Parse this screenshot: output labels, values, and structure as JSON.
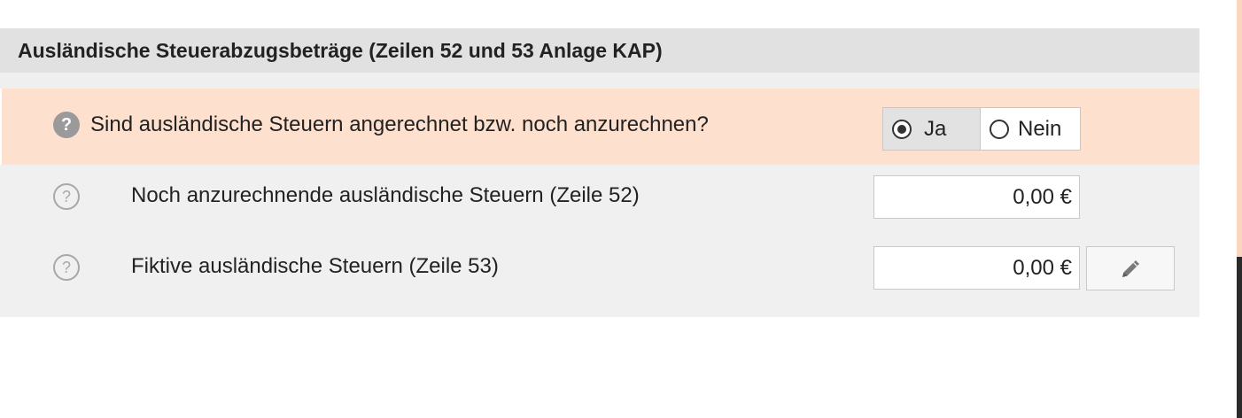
{
  "section": {
    "title": "Ausländische Steuerabzugsbeträge (Zeilen 52 und 53 Anlage KAP)"
  },
  "question": {
    "help_glyph": "?",
    "text": "Sind ausländische Steuern angerechnet bzw. noch anzurechnen?",
    "options": [
      {
        "label": "Ja",
        "selected": true
      },
      {
        "label": "Nein",
        "selected": false
      }
    ]
  },
  "fields": [
    {
      "help_glyph": "?",
      "label": "Noch anzurechnende ausländische Steuern (Zeile 52)",
      "value": "0,00 €"
    },
    {
      "help_glyph": "?",
      "label": "Fiktive ausländische Steuern (Zeile 53)",
      "value": "0,00 €",
      "action_icon": "pencil-icon"
    }
  ],
  "colors": {
    "header_bg": "#e1e1e1",
    "highlight_row_bg": "#fde0cd",
    "rows_bg": "#f0f0f0",
    "selected_option_bg": "#e2e2e2"
  }
}
